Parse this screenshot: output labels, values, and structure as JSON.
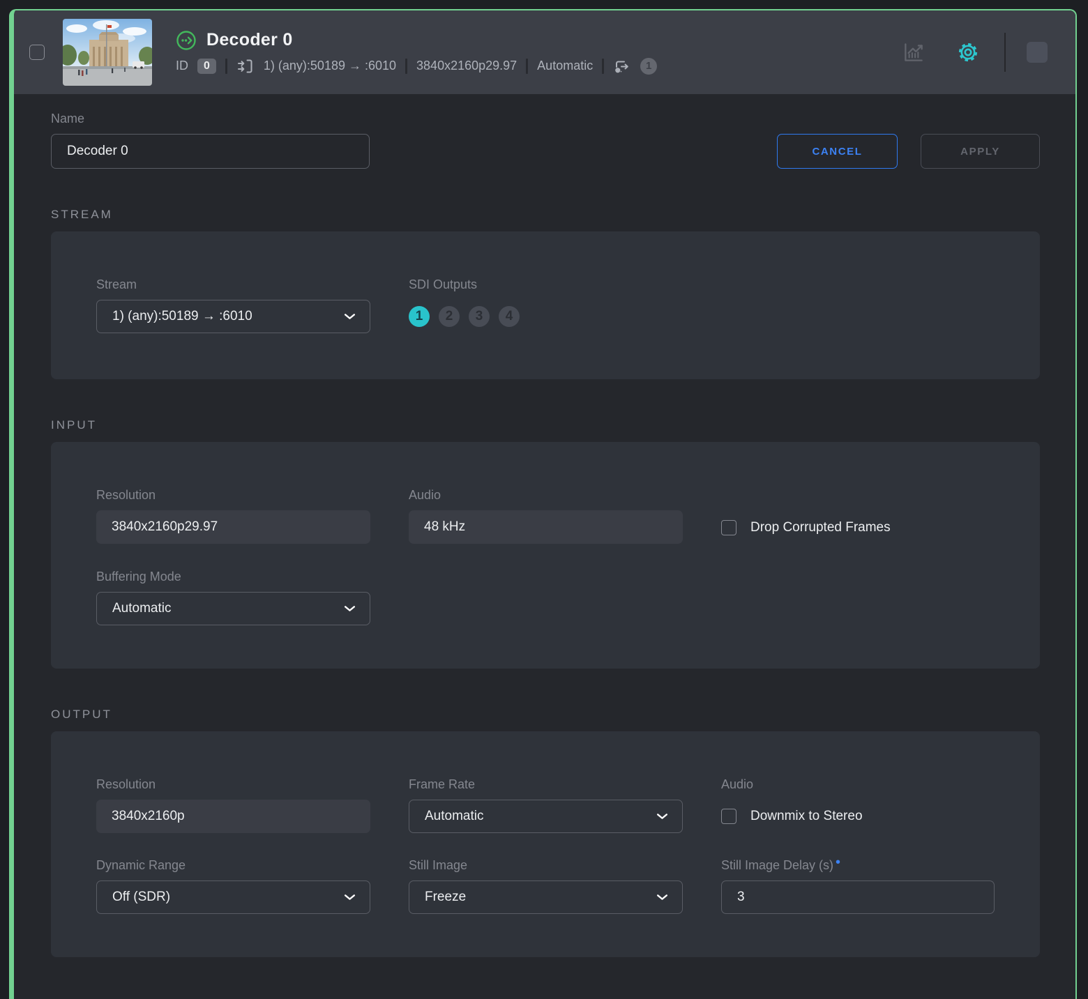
{
  "header": {
    "title": "Decoder 0",
    "id_label": "ID",
    "id_value": "0",
    "stream": "1) (any):50189 → :6010",
    "resolution": "3840x2160p29.97",
    "mode": "Automatic",
    "outputs_count": "1"
  },
  "form": {
    "name_label": "Name",
    "name_value": "Decoder 0",
    "cancel": "CANCEL",
    "apply": "APPLY"
  },
  "stream": {
    "title": "STREAM",
    "stream_label": "Stream",
    "stream_value": "1) (any):50189 → :6010",
    "sdi_label": "SDI Outputs",
    "sdi": [
      "1",
      "2",
      "3",
      "4"
    ],
    "sdi_active": "1"
  },
  "input": {
    "title": "INPUT",
    "resolution_label": "Resolution",
    "resolution_value": "3840x2160p29.97",
    "audio_label": "Audio",
    "audio_value": "48 kHz",
    "drop_label": "Drop Corrupted Frames",
    "buffering_label": "Buffering Mode",
    "buffering_value": "Automatic"
  },
  "output": {
    "title": "OUTPUT",
    "resolution_label": "Resolution",
    "resolution_value": "3840x2160p",
    "framerate_label": "Frame Rate",
    "framerate_value": "Automatic",
    "audio_label": "Audio",
    "downmix_label": "Downmix to Stereo",
    "dynrange_label": "Dynamic Range",
    "dynrange_value": "Off (SDR)",
    "still_label": "Still Image",
    "still_value": "Freeze",
    "delay_label": "Still Image Delay (s)",
    "delay_marker": "•",
    "delay_value": "3"
  },
  "colors": {
    "accent_teal": "#29c3cb",
    "accent_green_border": "#72d190",
    "status_green": "#43b85c",
    "accent_blue": "#2f7af0"
  }
}
